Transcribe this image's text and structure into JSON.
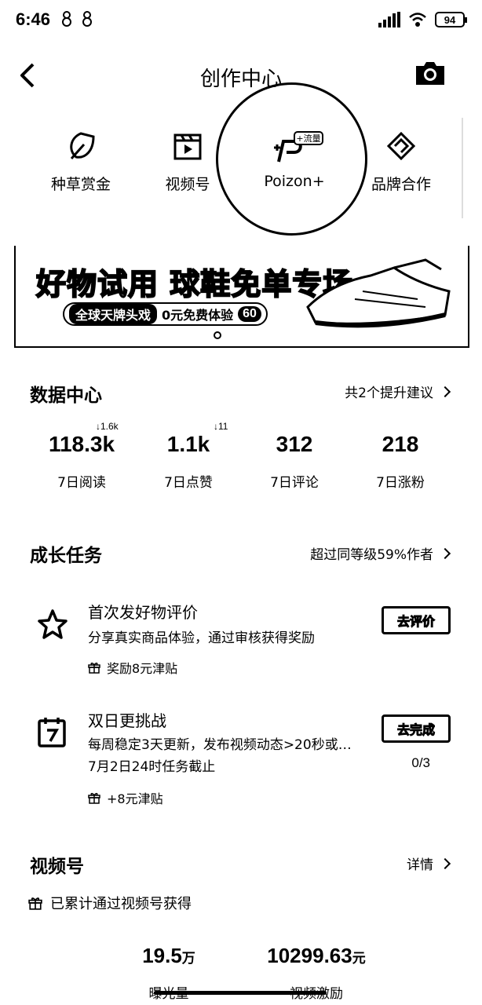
{
  "status_bar": {
    "time": "6:46",
    "battery": "94"
  },
  "header": {
    "title": "创作中心"
  },
  "quick_links": [
    {
      "label": "种草赏金",
      "icon": "leaf-icon"
    },
    {
      "label": "视频号",
      "icon": "video-icon"
    },
    {
      "label": "Poizon+",
      "icon": "poizon-icon",
      "badge": "+流量"
    },
    {
      "label": "品牌合作",
      "icon": "handshake-icon"
    }
  ],
  "banner": {
    "title": "好物试用 球鞋免单专场",
    "tag": "全球天牌头戏",
    "text": "0元免费体验",
    "num": "60"
  },
  "data_center": {
    "title": "数据中心",
    "link": "共2个提升建议",
    "stats": [
      {
        "value": "118.3k",
        "label": "7日阅读",
        "delta": "↓1.6k"
      },
      {
        "value": "1.1k",
        "label": "7日点赞",
        "delta": "↓11"
      },
      {
        "value": "312",
        "label": "7日评论"
      },
      {
        "value": "218",
        "label": "7日涨粉"
      }
    ]
  },
  "growth": {
    "title": "成长任务",
    "link": "超过同等级59%作者",
    "tasks": [
      {
        "title": "首次发好物评价",
        "desc": "分享真实商品体验，通过审核获得奖励",
        "reward": "奖励8元津贴",
        "button": "去评价"
      },
      {
        "title": "双日更挑战",
        "desc": "每周稳定3天更新，发布视频动态>20秒或…",
        "deadline": "7月2日24时任务截止",
        "progress": "0/3",
        "reward": "+8元津贴",
        "button": "去完成"
      }
    ]
  },
  "video": {
    "title": "视频号",
    "link": "详情",
    "total_text": "已累计通过视频号获得",
    "stats": [
      {
        "value": "19.5",
        "unit": "万",
        "label": "曝光量"
      },
      {
        "value": "10299.63",
        "unit": "元",
        "label": "视频激励"
      }
    ]
  }
}
